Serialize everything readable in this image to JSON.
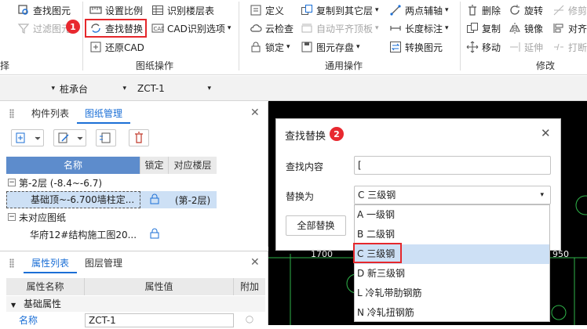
{
  "ribbon": {
    "group1": {
      "find_drawing": "查找图元",
      "filter_drawing": "过滤图元",
      "group_label": "择"
    },
    "group2": {
      "set_scale": "设置比例",
      "identify_floor_table": "识别楼层表",
      "find_replace": "查找替换",
      "cad_identify_options": "CAD识别选项",
      "restore_cad": "还原CAD",
      "group_label": "图纸操作"
    },
    "group3": {
      "define": "定义",
      "copy_to_other_floor": "复制到其它层",
      "two_point_axis": "两点辅轴",
      "cloud_check": "云检查",
      "auto_flat_top": "自动平齐顶板",
      "length_dim": "长度标注",
      "lock": "锁定",
      "element_save": "图元存盘",
      "convert_element": "转换图元",
      "group_label": "通用操作"
    },
    "group4": {
      "delete": "删除",
      "rotate": "旋转",
      "trim": "修剪",
      "copy": "复制",
      "mirror": "镜像",
      "align": "对齐",
      "move": "移动",
      "extend": "延伸",
      "break": "打断",
      "group_label": "修改"
    },
    "badge1": "1",
    "badge2": "2"
  },
  "toolbar2": {
    "combo1": "",
    "combo2": "桩承台",
    "combo3": "ZCT-1"
  },
  "left_panel": {
    "tabs": [
      "构件列表",
      "图纸管理"
    ],
    "table_headers": [
      "名称",
      "锁定",
      "对应楼层"
    ],
    "rows": [
      {
        "name": "第-2层 (-8.4~-6.7)",
        "floor": ""
      },
      {
        "name": "基础顶~-6.700墙柱定...",
        "floor": "(第-2层)"
      },
      {
        "name": "未对应图纸",
        "floor": ""
      },
      {
        "name": "华府12#结构施工图20...",
        "floor": ""
      }
    ],
    "prop_tabs": [
      "属性列表",
      "图层管理"
    ],
    "prop_headers": [
      "属性名称",
      "属性值",
      "附加"
    ],
    "prop_group": "基础属性",
    "prop_rows": [
      {
        "name": "名称",
        "value": "ZCT-1"
      }
    ]
  },
  "cad": {
    "dim_left": "1700",
    "dim_right": "950"
  },
  "dialog": {
    "title": "查找替换",
    "find_label": "查找内容",
    "find_value": "[",
    "replace_label": "替换为",
    "replace_value": "C 三级钢",
    "replace_all": "全部替换",
    "options": [
      "A 一级钢",
      "B 二级钢",
      "C 三级钢",
      "D 新三级钢",
      "L 冷轧带肋钢筋",
      "N 冷轧扭钢筋"
    ]
  },
  "colors": {
    "accent": "#1b6fd6",
    "highlight": "#e5282c",
    "selection": "#cde0f5"
  }
}
